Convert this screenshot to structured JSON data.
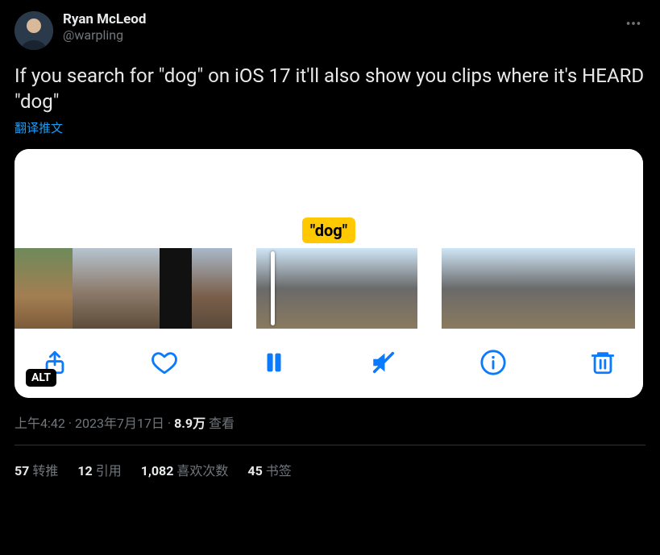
{
  "author": {
    "display_name": "Ryan McLeod",
    "handle": "@warpling"
  },
  "tweet_text": "If you search for \"dog\" on iOS 17 it'll also show you clips where it's HEARD \"dog\"",
  "translate_label": "翻译推文",
  "media": {
    "search_token": "\"dog\"",
    "alt_badge": "ALT"
  },
  "meta": {
    "time": "上午4:42",
    "separator": " · ",
    "date": "2023年7月17日",
    "views_count": "8.9万",
    "views_label": " 查看"
  },
  "stats": {
    "retweets_count": "57",
    "retweets_label": "转推",
    "quotes_count": "12",
    "quotes_label": "引用",
    "likes_count": "1,082",
    "likes_label": "喜欢次数",
    "bookmarks_count": "45",
    "bookmarks_label": "书签"
  }
}
